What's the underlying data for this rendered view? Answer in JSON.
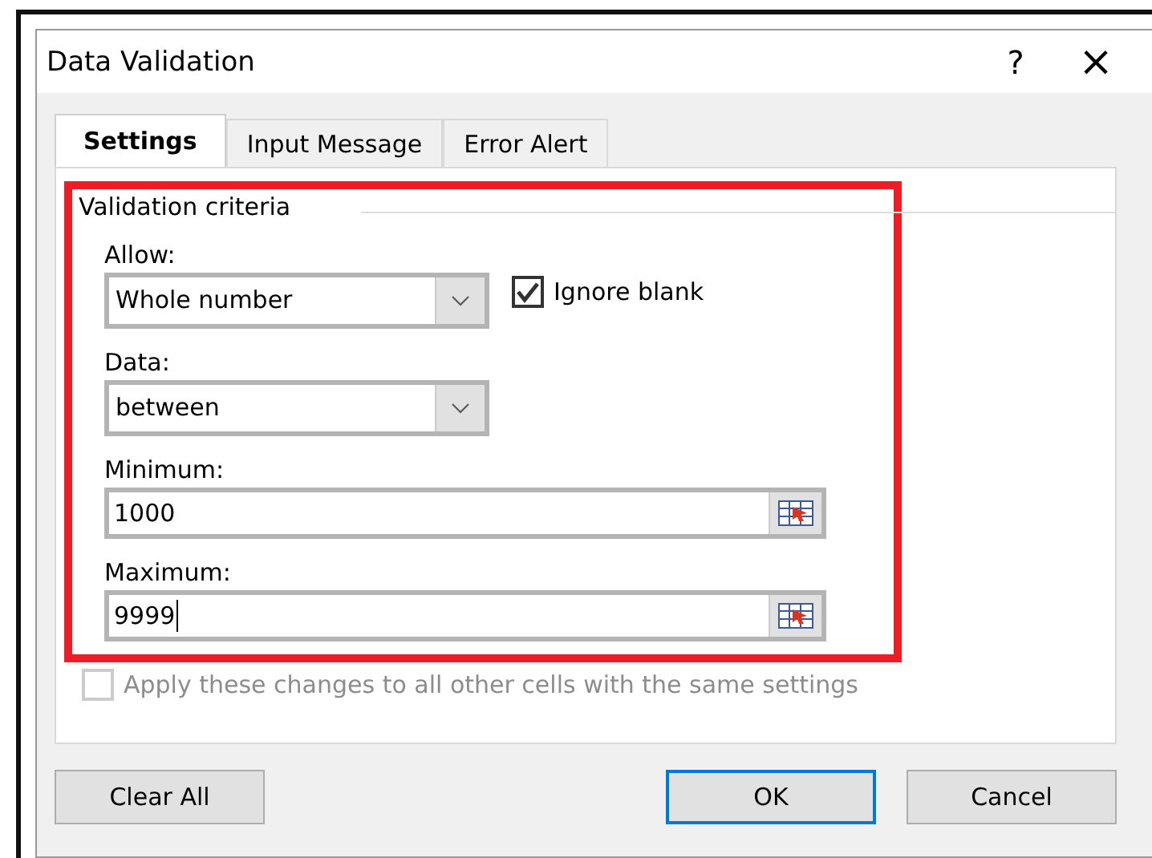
{
  "window": {
    "title": "Data Validation",
    "help": "?",
    "close": "×"
  },
  "tabs": [
    {
      "label": "Settings",
      "selected": true
    },
    {
      "label": "Input Message",
      "selected": false
    },
    {
      "label": "Error Alert",
      "selected": false
    }
  ],
  "criteria": {
    "title": "Validation criteria",
    "highlighted": true,
    "fields": [
      {
        "kind": "dropdown",
        "label": "Allow:",
        "value": "Whole number",
        "checkbox": {
          "label": "Ignore blank",
          "checked": true
        }
      },
      {
        "kind": "dropdown",
        "label": "Data:",
        "value": "between"
      },
      {
        "kind": "range",
        "label": "Minimum:",
        "value": "1000",
        "focused": false
      },
      {
        "kind": "range",
        "label": "Maximum:",
        "value": "9999",
        "focused": true
      }
    ]
  },
  "apply_all": {
    "label": "Apply these changes to all other cells with the same settings",
    "checked": false,
    "disabled": true
  },
  "buttons": [
    {
      "label": "Clear All",
      "kind": "left",
      "default": false
    },
    {
      "label": "OK",
      "kind": "right",
      "default": true
    },
    {
      "label": "Cancel",
      "kind": "right",
      "default": false
    }
  ]
}
